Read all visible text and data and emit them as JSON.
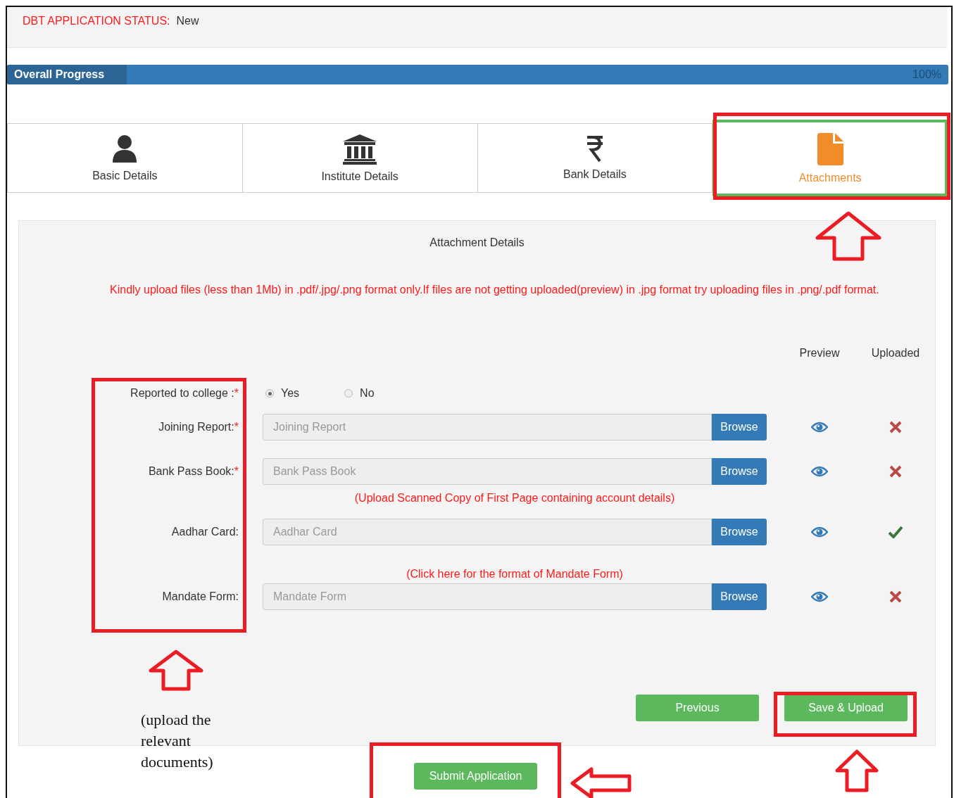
{
  "status": {
    "label": "DBT APPLICATION STATUS:",
    "value": "New"
  },
  "progress": {
    "label": "Overall Progress",
    "level": 1,
    "reading": "100%"
  },
  "tabs": [
    {
      "label": "Basic Details",
      "selected": false
    },
    {
      "label": "Institute Details",
      "selected": false
    },
    {
      "label": "Bank Details",
      "selected": false
    },
    {
      "label": "Attachments",
      "selected": true
    }
  ],
  "panel": {
    "title": "Attachment Details",
    "notice": "Kindly upload files (less than 1Mb) in .pdf/.jpg/.png format only.If files are not getting uploaded(preview) in .jpg format try uploading files in .png/.pdf format.",
    "columns": [
      "Preview",
      "Uploaded"
    ],
    "rows": [
      {
        "kind": "radio",
        "label": "Reported to college :",
        "required_mark": "*",
        "options": [
          {
            "label": "Yes",
            "selected": true
          },
          {
            "label": "No",
            "selected": false
          }
        ]
      },
      {
        "kind": "upload",
        "label": "Joining Report:",
        "required_mark": "*",
        "placeholder": "Joining Report",
        "button": "Browse",
        "uploaded": false
      },
      {
        "kind": "upload",
        "label": "Bank Pass Book:",
        "required_mark": "*",
        "placeholder": "Bank Pass Book",
        "button": "Browse",
        "uploaded": false
      },
      {
        "kind": "note",
        "text": "(Upload Scanned Copy of First Page containing account details)"
      },
      {
        "kind": "upload",
        "label": "Aadhar Card:",
        "placeholder": "Aadhar Card",
        "button": "Browse",
        "uploaded": true
      },
      {
        "kind": "link",
        "text": "(Click here for the format of Mandate Form)"
      },
      {
        "kind": "upload",
        "label": "Mandate Form:",
        "placeholder": "Mandate Form",
        "button": "Browse",
        "uploaded": false
      }
    ],
    "buttons": [
      "Previous",
      "Save & Upload"
    ]
  },
  "submit": "Submit Application",
  "annotation": {
    "note": "(upload the relevant documents)"
  }
}
